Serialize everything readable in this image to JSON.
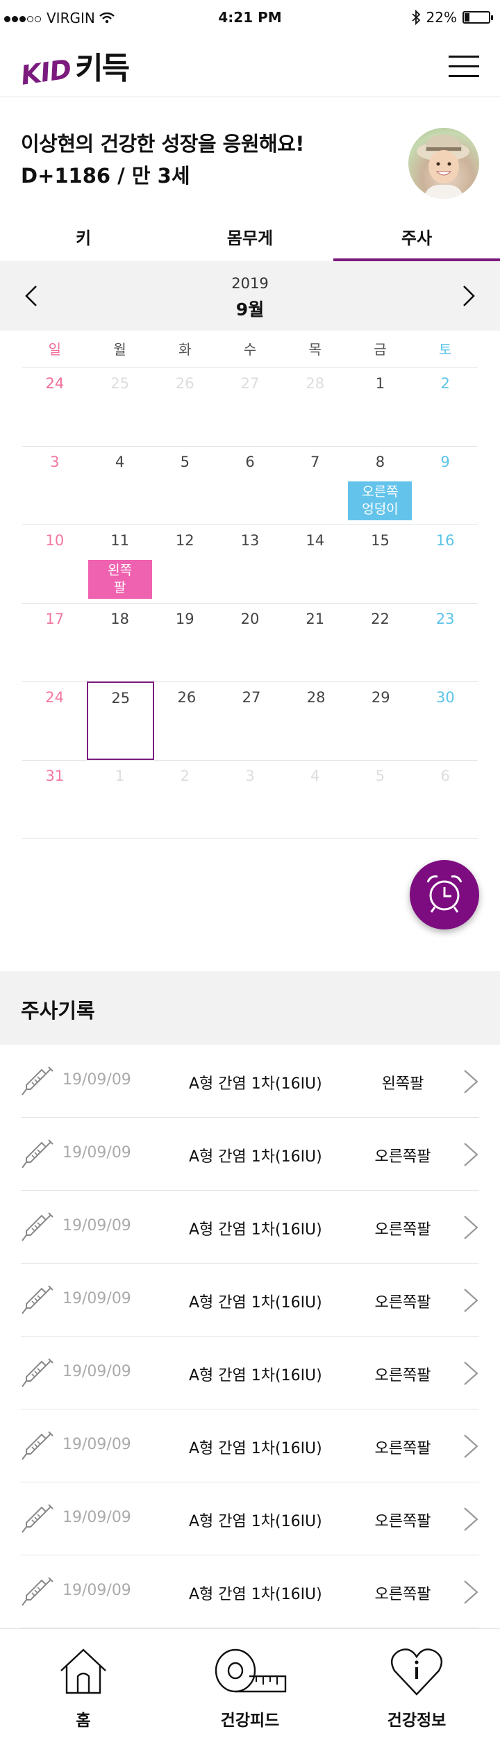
{
  "status": {
    "carrier": "VIRGIN",
    "time": "4:21 PM",
    "battery": "22%",
    "battery_level": 0.22
  },
  "header": {
    "logo_en": "KID",
    "logo_ko": "키득"
  },
  "child": {
    "greeting": "이상현의 건강한 성장을 응원해요!",
    "age": "D+1186 / 만 3세"
  },
  "tabs": [
    {
      "label": "키",
      "active": false
    },
    {
      "label": "몸무게",
      "active": false
    },
    {
      "label": "주사",
      "active": true
    }
  ],
  "calendar": {
    "year": "2019",
    "month": "9월",
    "weekdays": [
      "일",
      "월",
      "화",
      "수",
      "목",
      "금",
      "토"
    ],
    "weeks": [
      [
        {
          "n": "24",
          "other": true
        },
        {
          "n": "25",
          "other": true
        },
        {
          "n": "26",
          "other": true
        },
        {
          "n": "27",
          "other": true
        },
        {
          "n": "28",
          "other": true
        },
        {
          "n": "1"
        },
        {
          "n": "2"
        }
      ],
      [
        {
          "n": "3"
        },
        {
          "n": "4"
        },
        {
          "n": "5"
        },
        {
          "n": "6"
        },
        {
          "n": "7"
        },
        {
          "n": "8",
          "badge": "오른쪽\n엉덩이",
          "badge_type": "right"
        },
        {
          "n": "9"
        }
      ],
      [
        {
          "n": "10"
        },
        {
          "n": "11",
          "badge": "왼쪽\n팔",
          "badge_type": "left"
        },
        {
          "n": "12"
        },
        {
          "n": "13"
        },
        {
          "n": "14"
        },
        {
          "n": "15"
        },
        {
          "n": "16"
        }
      ],
      [
        {
          "n": "17"
        },
        {
          "n": "18"
        },
        {
          "n": "19"
        },
        {
          "n": "20"
        },
        {
          "n": "21"
        },
        {
          "n": "22"
        },
        {
          "n": "23"
        }
      ],
      [
        {
          "n": "24"
        },
        {
          "n": "25",
          "today": true
        },
        {
          "n": "26"
        },
        {
          "n": "27"
        },
        {
          "n": "28"
        },
        {
          "n": "29"
        },
        {
          "n": "30"
        }
      ],
      [
        {
          "n": "31"
        },
        {
          "n": "1",
          "other": true
        },
        {
          "n": "2",
          "other": true
        },
        {
          "n": "3",
          "other": true
        },
        {
          "n": "4",
          "other": true
        },
        {
          "n": "5",
          "other": true
        },
        {
          "n": "6",
          "other": true
        }
      ]
    ]
  },
  "records": {
    "title": "주사기록",
    "items": [
      {
        "date": "19/09/09",
        "vaccine": "A형 간염 1차(16IU)",
        "site": "왼쪽팔"
      },
      {
        "date": "19/09/09",
        "vaccine": "A형 간염 1차(16IU)",
        "site": "오른쪽팔"
      },
      {
        "date": "19/09/09",
        "vaccine": "A형 간염 1차(16IU)",
        "site": "오른쪽팔"
      },
      {
        "date": "19/09/09",
        "vaccine": "A형 간염 1차(16IU)",
        "site": "오른쪽팔"
      },
      {
        "date": "19/09/09",
        "vaccine": "A형 간염 1차(16IU)",
        "site": "오른쪽팔"
      },
      {
        "date": "19/09/09",
        "vaccine": "A형 간염 1차(16IU)",
        "site": "오른쪽팔"
      },
      {
        "date": "19/09/09",
        "vaccine": "A형 간염 1차(16IU)",
        "site": "오른쪽팔"
      },
      {
        "date": "19/09/09",
        "vaccine": "A형 간염 1차(16IU)",
        "site": "오른쪽팔"
      }
    ]
  },
  "bottom_nav": [
    {
      "label": "홈",
      "icon": "home-icon"
    },
    {
      "label": "건강피드",
      "icon": "tape-measure-icon"
    },
    {
      "label": "건강정보",
      "icon": "heart-info-icon"
    }
  ],
  "colors": {
    "accent": "#7a1a7d",
    "sunday": "#f3779f",
    "saturday": "#5bc4e8",
    "badge_right": "#64c3ea",
    "badge_left": "#ef62b0"
  }
}
